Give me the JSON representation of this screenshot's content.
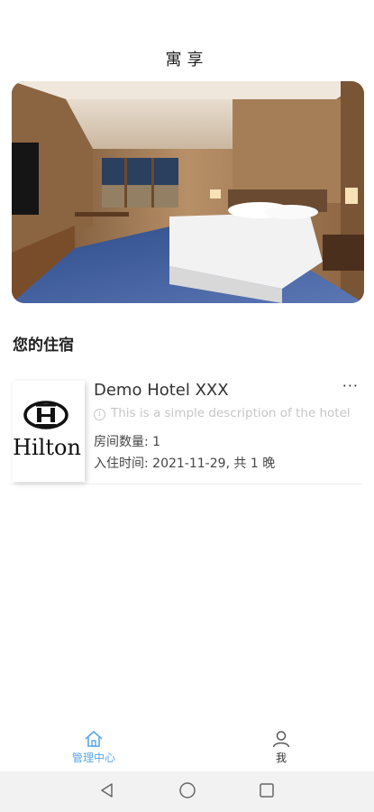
{
  "header": {
    "title": "寓享"
  },
  "hero": {
    "image": "hotel-room-photo"
  },
  "section": {
    "title": "您的住宿"
  },
  "stay": {
    "logo_text": "Hilton",
    "hotel_name": "Demo Hotel XXX",
    "more_label": "···",
    "description": "This is a simple description of the hotel",
    "rooms": "房间数量: 1",
    "checkin": "入住时间: 2021-11-29, 共 1 晚"
  },
  "tabbar": {
    "tabs": [
      {
        "label": "管理中心",
        "icon": "home-icon",
        "active": true
      },
      {
        "label": "我",
        "icon": "user-icon",
        "active": false
      }
    ],
    "active_color": "#5aa6e8"
  },
  "system_nav": {
    "buttons": [
      "back-icon",
      "home-circle-icon",
      "recents-icon"
    ]
  }
}
